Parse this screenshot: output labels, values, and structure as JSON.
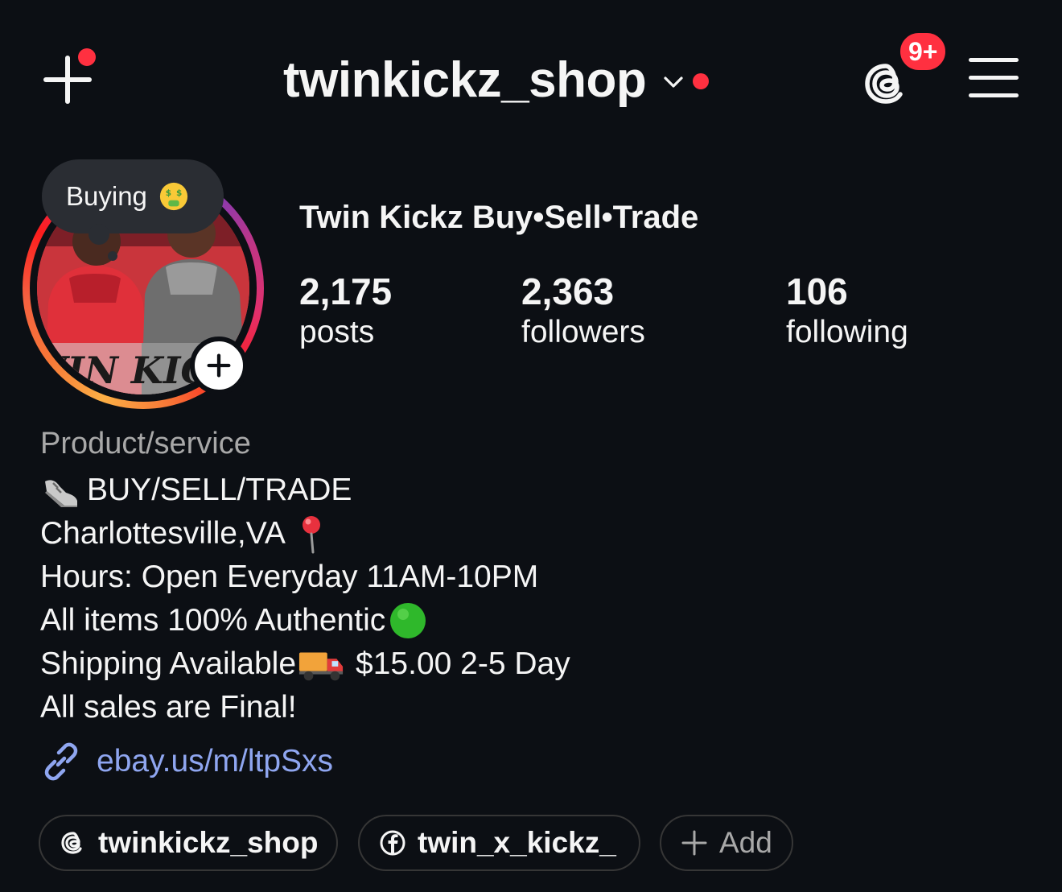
{
  "header": {
    "username": "twinkickz_shop",
    "notification_badge": "9+",
    "create_icon": "plus-icon",
    "threads_icon": "threads-icon",
    "menu_icon": "hamburger-menu-icon",
    "dropdown_icon": "chevron-down-icon",
    "alert_color": "#ff3040"
  },
  "profile": {
    "note": "Buying",
    "note_emoji": "money-mouth-face-emoji",
    "display_name": "Twin Kickz Buy•Sell•Trade",
    "avatar_text": "TWIN KICKZ",
    "stats": [
      {
        "value": "2,175",
        "label": "posts"
      },
      {
        "value": "2,363",
        "label": "followers"
      },
      {
        "value": "106",
        "label": "following"
      }
    ],
    "category": "Product/service",
    "bio": [
      "BUY/SELL/TRADE",
      "Charlottesville,VA",
      "Hours: Open Everyday 11AM-10PM",
      "All items 100% Authentic",
      "Shipping Available",
      "$15.00 2-5 Day",
      "All sales are Final!"
    ],
    "bio_emojis": [
      "sneaker-emoji",
      "round-pushpin-emoji",
      "green-circle-emoji",
      "delivery-truck-emoji"
    ],
    "link": "ebay.us/m/ltpSxs",
    "link_color": "#8fa6f0"
  },
  "chips": [
    {
      "label": "twinkickz_shop",
      "icon": "threads-icon"
    },
    {
      "label": "twin_x_kickz_",
      "icon": "facebook-icon"
    },
    {
      "label": "Add",
      "icon": "plus-icon"
    }
  ]
}
